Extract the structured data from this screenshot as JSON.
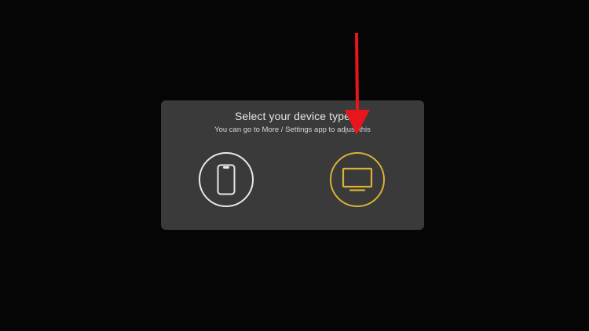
{
  "dialog": {
    "title": "Select your device type",
    "subtitle": "You can go to More / Settings app to adjust this",
    "options": [
      {
        "name": "phone",
        "icon": "phone-icon",
        "color": "#e8e8e8",
        "selected": false
      },
      {
        "name": "tv",
        "icon": "tv-icon",
        "color": "#d9b236",
        "selected": true
      }
    ]
  },
  "annotation": {
    "icon": "arrow-down-icon",
    "color": "#e8161b"
  }
}
